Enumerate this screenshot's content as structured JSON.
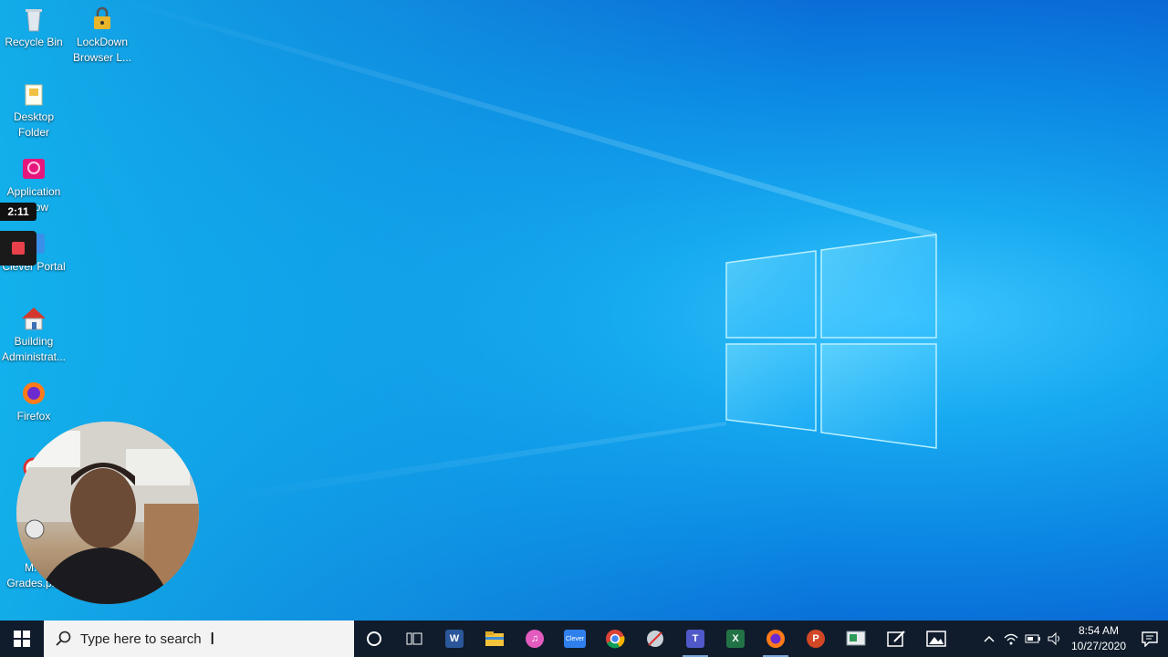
{
  "desktop": {
    "icons": [
      {
        "label": "Recycle Bin",
        "icon": "recycle-bin-icon"
      },
      {
        "label": "LockDown Browser L...",
        "icon": "lockdown-browser-icon"
      },
      {
        "label": "Desktop Folder",
        "icon": "folder-icon"
      },
      {
        "label": "Application ...dow",
        "icon": "application-window-icon"
      },
      {
        "label": "Clever Portal",
        "icon": "clever-icon"
      },
      {
        "label": "Building Administrat...",
        "icon": "building-admin-icon"
      },
      {
        "label": "Firefox",
        "icon": "firefox-icon"
      },
      {
        "label": "M... Grades.p...",
        "icon": "grades-file-icon"
      }
    ]
  },
  "recorder": {
    "elapsed": "2:11"
  },
  "taskbar": {
    "search_placeholder": "Type here to search",
    "pinned": [
      {
        "name": "cortana",
        "glyph": ""
      },
      {
        "name": "task-view",
        "glyph": ""
      },
      {
        "name": "word",
        "glyph": "W",
        "color": "#2b579a"
      },
      {
        "name": "file-explorer",
        "glyph": "",
        "color": "#f4c23b"
      },
      {
        "name": "itunes",
        "glyph": "♫",
        "color": "#e35bbf"
      },
      {
        "name": "clever",
        "glyph": "Clever",
        "color": "#2f80ed"
      },
      {
        "name": "chrome",
        "glyph": "",
        "color": "#34a853"
      },
      {
        "name": "snipping-tool",
        "glyph": "",
        "color": "#9aa7b3"
      },
      {
        "name": "teams",
        "glyph": "T",
        "color": "#5059c9"
      },
      {
        "name": "excel",
        "glyph": "X",
        "color": "#217346"
      },
      {
        "name": "firefox",
        "glyph": "",
        "color": "#ff7a18"
      },
      {
        "name": "powerpoint",
        "glyph": "P",
        "color": "#d24726"
      },
      {
        "name": "remote-desktop",
        "glyph": "",
        "color": "#7a8a95"
      },
      {
        "name": "whiteboard",
        "glyph": "",
        "color": "#ffffff"
      },
      {
        "name": "photos",
        "glyph": "",
        "color": "#ffffff"
      }
    ],
    "time": "8:54 AM",
    "date": "10/27/2020"
  }
}
